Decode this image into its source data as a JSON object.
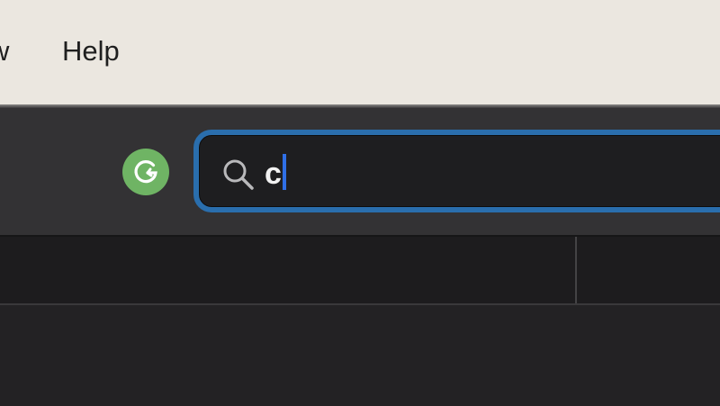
{
  "menubar": {
    "items": [
      {
        "label": "w"
      },
      {
        "label": "Help"
      }
    ]
  },
  "toolbar": {
    "extension_icon": "grammarly-icon",
    "search": {
      "value": "c",
      "icon": "search-icon",
      "focused": true
    }
  },
  "colors": {
    "menubar_bg": "#ebe7e0",
    "toolbar_bg": "#333234",
    "focus_ring": "#2a6ead",
    "caret": "#2f6fe6",
    "grammarly": "#6fb464"
  }
}
